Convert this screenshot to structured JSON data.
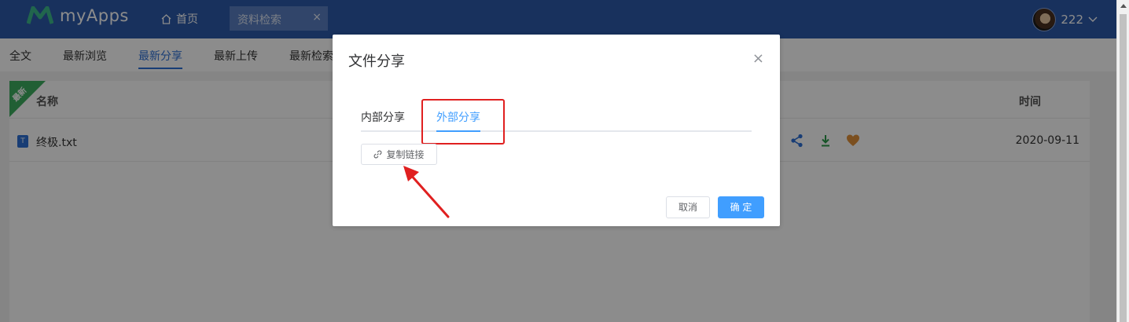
{
  "header": {
    "brand": "myApps",
    "home_label": "首页",
    "active_tab": "资料检索",
    "close_glyph": "×",
    "username": "222",
    "bg_color": "#2d5aa9"
  },
  "subnav": {
    "items": [
      "全文",
      "最新浏览",
      "最新分享",
      "最新上传",
      "最新检索"
    ],
    "active": "最新分享"
  },
  "table": {
    "ribbon": "最新",
    "col_name": "名称",
    "col_time": "时间",
    "rows": [
      {
        "name": "终极.txt",
        "date": "2020-09-11",
        "icon": "T"
      }
    ],
    "action_icons": [
      "share-icon",
      "download-icon",
      "heart-icon"
    ]
  },
  "dialog": {
    "title": "文件分享",
    "close_glyph": "×",
    "tabs": [
      "内部分享",
      "外部分享"
    ],
    "active_tab": "外部分享",
    "copy_link": "复制链接",
    "cancel": "取消",
    "confirm": "确 定",
    "accent": "#409eff"
  }
}
